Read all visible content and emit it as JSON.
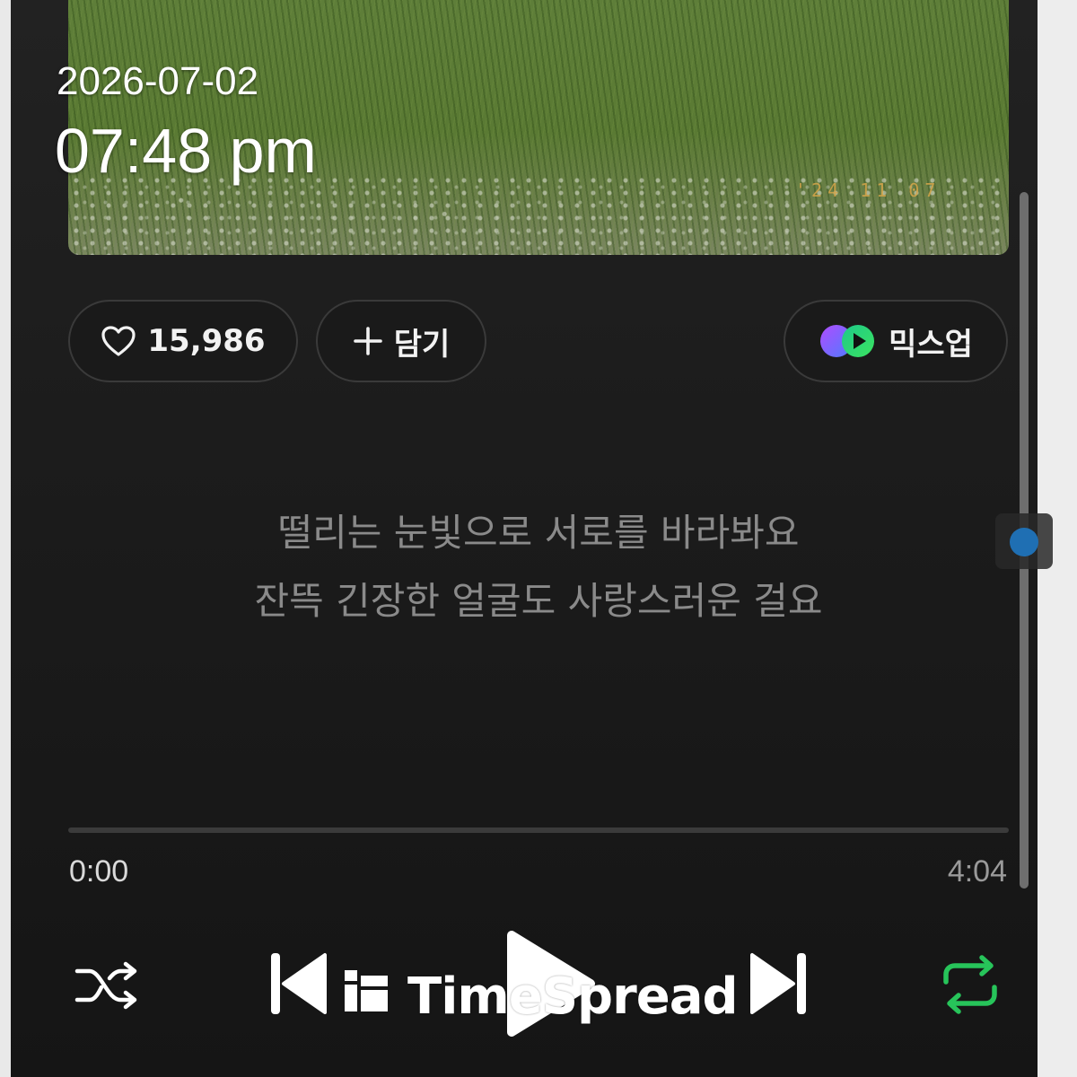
{
  "overlay": {
    "date": "2026-07-02",
    "time": "07:48 pm"
  },
  "album_art": {
    "alt": "grass field photo",
    "stamp": "'24 11 07"
  },
  "actions": {
    "like_count": "15,986",
    "add_label": "담기",
    "mixup_label": "믹스업"
  },
  "lyrics": {
    "lines": [
      "떨리는 눈빛으로 서로를 바라봐요",
      "잔뜩 긴장한 얼굴도 사랑스러운 걸요"
    ]
  },
  "playback": {
    "elapsed": "0:00",
    "total": "4:04",
    "progress": 0.0
  },
  "controls": {
    "shuffle_icon": "shuffle-icon",
    "prev_icon": "skip-previous-icon",
    "play_icon": "play-icon",
    "next_icon": "skip-next-icon",
    "repeat_icon": "repeat-icon",
    "repeat_color": "#27c45a"
  },
  "watermark": {
    "text": "TimeSpread"
  },
  "colors": {
    "background": "#151515",
    "pill_border": "#3a3a3a",
    "lyrics_text": "#8a8a8a",
    "scroll_dot": "#1f6fb3",
    "mixup_purple": "#7b5cff",
    "mixup_green": "#2bd46b"
  }
}
